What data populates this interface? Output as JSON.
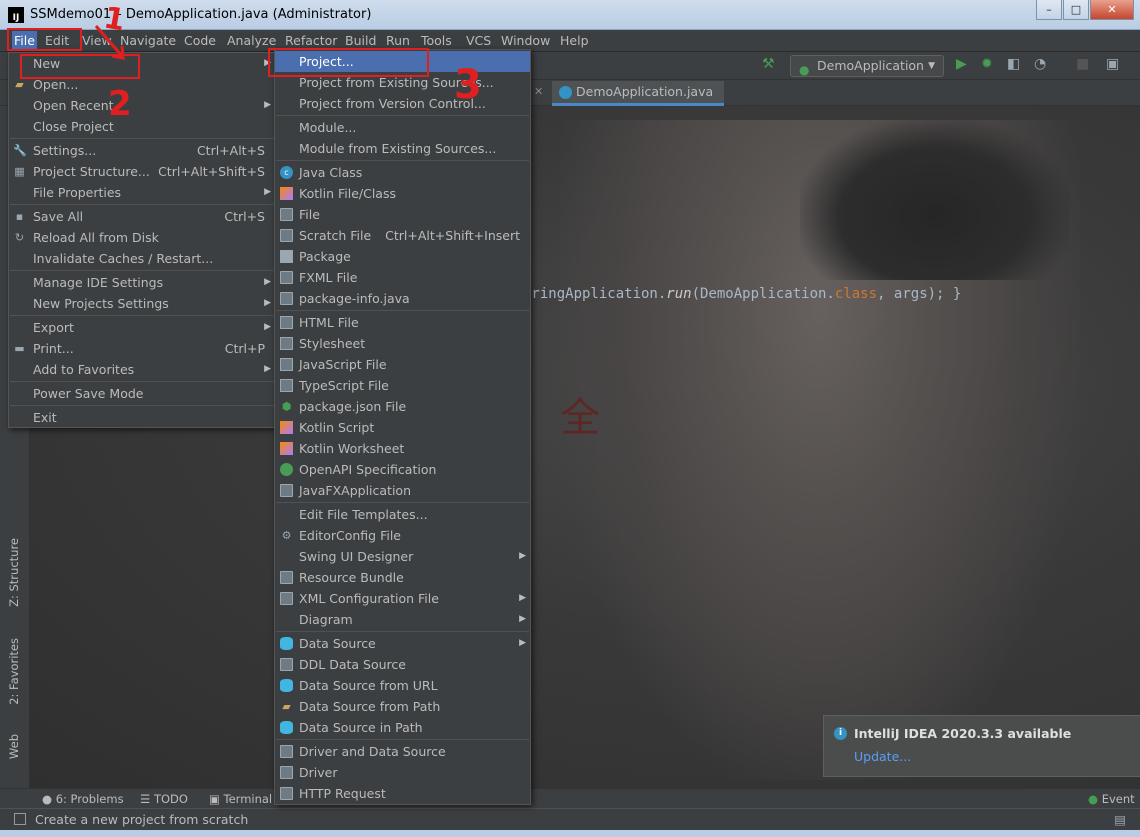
{
  "window": {
    "title": "SSMdemo01 – DemoApplication.java (Administrator)",
    "app_icon": "IJ",
    "buttons": {
      "minimize": "–",
      "maximize": "□",
      "close": "✕"
    }
  },
  "menubar": [
    "File",
    "Edit",
    "View",
    "Navigate",
    "Code",
    "Analyze",
    "Refactor",
    "Build",
    "Run",
    "Tools",
    "VCS",
    "Window",
    "Help"
  ],
  "toolbar": {
    "run_config": "DemoApplication",
    "icons": [
      "build-hammer-icon",
      "run-icon",
      "debug-icon",
      "coverage-icon",
      "profile-icon",
      "stop-icon",
      "project-structure-icon"
    ]
  },
  "editor": {
    "tab": "DemoApplication.java",
    "code": {
      "pre": "pringApplication.",
      "method": "run",
      "mid": "(DemoApplication.",
      "kw": "class",
      "post": ", args); }"
    }
  },
  "file_menu": [
    {
      "label": "New",
      "arrow": true
    },
    {
      "label": "Open...",
      "icon": "folder-icon"
    },
    {
      "label": "Open Recent",
      "arrow": true
    },
    {
      "label": "Close Project"
    },
    {
      "sep": true
    },
    {
      "label": "Settings...",
      "shortcut": "Ctrl+Alt+S",
      "icon": "wrench-icon"
    },
    {
      "label": "Project Structure...",
      "shortcut": "Ctrl+Alt+Shift+S",
      "icon": "project-structure-icon"
    },
    {
      "label": "File Properties",
      "arrow": true
    },
    {
      "sep": true
    },
    {
      "label": "Save All",
      "shortcut": "Ctrl+S",
      "icon": "save-icon"
    },
    {
      "label": "Reload All from Disk",
      "icon": "reload-icon"
    },
    {
      "label": "Invalidate Caches / Restart..."
    },
    {
      "sep": true
    },
    {
      "label": "Manage IDE Settings",
      "arrow": true
    },
    {
      "label": "New Projects Settings",
      "arrow": true
    },
    {
      "sep": true
    },
    {
      "label": "Export",
      "arrow": true
    },
    {
      "label": "Print...",
      "shortcut": "Ctrl+P",
      "icon": "print-icon"
    },
    {
      "label": "Add to Favorites",
      "arrow": true
    },
    {
      "sep": true
    },
    {
      "label": "Power Save Mode"
    },
    {
      "sep": true
    },
    {
      "label": "Exit"
    }
  ],
  "new_menu": [
    {
      "label": "Project...",
      "selected": true
    },
    {
      "label": "Project from Existing Sources..."
    },
    {
      "label": "Project from Version Control..."
    },
    {
      "sep": true
    },
    {
      "label": "Module..."
    },
    {
      "label": "Module from Existing Sources..."
    },
    {
      "sep": true
    },
    {
      "label": "Java Class",
      "icon": "java-class-icon"
    },
    {
      "label": "Kotlin File/Class",
      "icon": "kotlin-icon"
    },
    {
      "label": "File",
      "icon": "file-icon"
    },
    {
      "label": "Scratch File",
      "shortcut": "Ctrl+Alt+Shift+Insert",
      "icon": "scratch-file-icon"
    },
    {
      "label": "Package",
      "icon": "package-icon"
    },
    {
      "label": "FXML File",
      "icon": "fxml-icon"
    },
    {
      "label": "package-info.java",
      "icon": "file-icon"
    },
    {
      "sep": true
    },
    {
      "label": "HTML File",
      "icon": "html-icon"
    },
    {
      "label": "Stylesheet",
      "icon": "css-icon"
    },
    {
      "label": "JavaScript File",
      "icon": "javascript-icon"
    },
    {
      "label": "TypeScript File",
      "icon": "typescript-icon"
    },
    {
      "label": "package.json File",
      "icon": "nodejs-icon"
    },
    {
      "label": "Kotlin Script",
      "icon": "kotlin-script-icon"
    },
    {
      "label": "Kotlin Worksheet",
      "icon": "kotlin-worksheet-icon"
    },
    {
      "label": "OpenAPI Specification",
      "icon": "openapi-icon"
    },
    {
      "label": "JavaFXApplication",
      "icon": "file-icon"
    },
    {
      "sep": true
    },
    {
      "label": "Edit File Templates..."
    },
    {
      "label": "EditorConfig File",
      "icon": "gear-icon"
    },
    {
      "label": "Swing UI Designer",
      "arrow": true
    },
    {
      "label": "Resource Bundle",
      "icon": "resource-bundle-icon"
    },
    {
      "label": "XML Configuration File",
      "arrow": true,
      "icon": "xml-icon"
    },
    {
      "label": "Diagram",
      "arrow": true
    },
    {
      "sep": true
    },
    {
      "label": "Data Source",
      "arrow": true,
      "icon": "database-icon"
    },
    {
      "label": "DDL Data Source",
      "icon": "ddl-icon"
    },
    {
      "label": "Data Source from URL",
      "icon": "database-icon"
    },
    {
      "label": "Data Source from Path",
      "icon": "folder-icon"
    },
    {
      "label": "Data Source in Path",
      "icon": "database-icon"
    },
    {
      "sep": true
    },
    {
      "label": "Driver and Data Source",
      "icon": "driver-icon"
    },
    {
      "label": "Driver",
      "icon": "driver-icon"
    },
    {
      "label": "HTTP Request",
      "icon": "api-icon"
    }
  ],
  "left_tools": [
    "Z: Structure",
    "2: Favorites",
    "Web"
  ],
  "bottom_tools": [
    "6: Problems",
    "TODO",
    "Terminal"
  ],
  "event_log": "Event L",
  "status": "Create a new project from scratch",
  "notification": {
    "title": "IntelliJ IDEA 2020.3.3 available",
    "link": "Update..."
  },
  "annotations": [
    "1",
    "2",
    "3"
  ],
  "colors": {
    "menu_bg": "#3c3f41",
    "selection": "#4b6eaf",
    "annotation_red": "#e02020"
  }
}
